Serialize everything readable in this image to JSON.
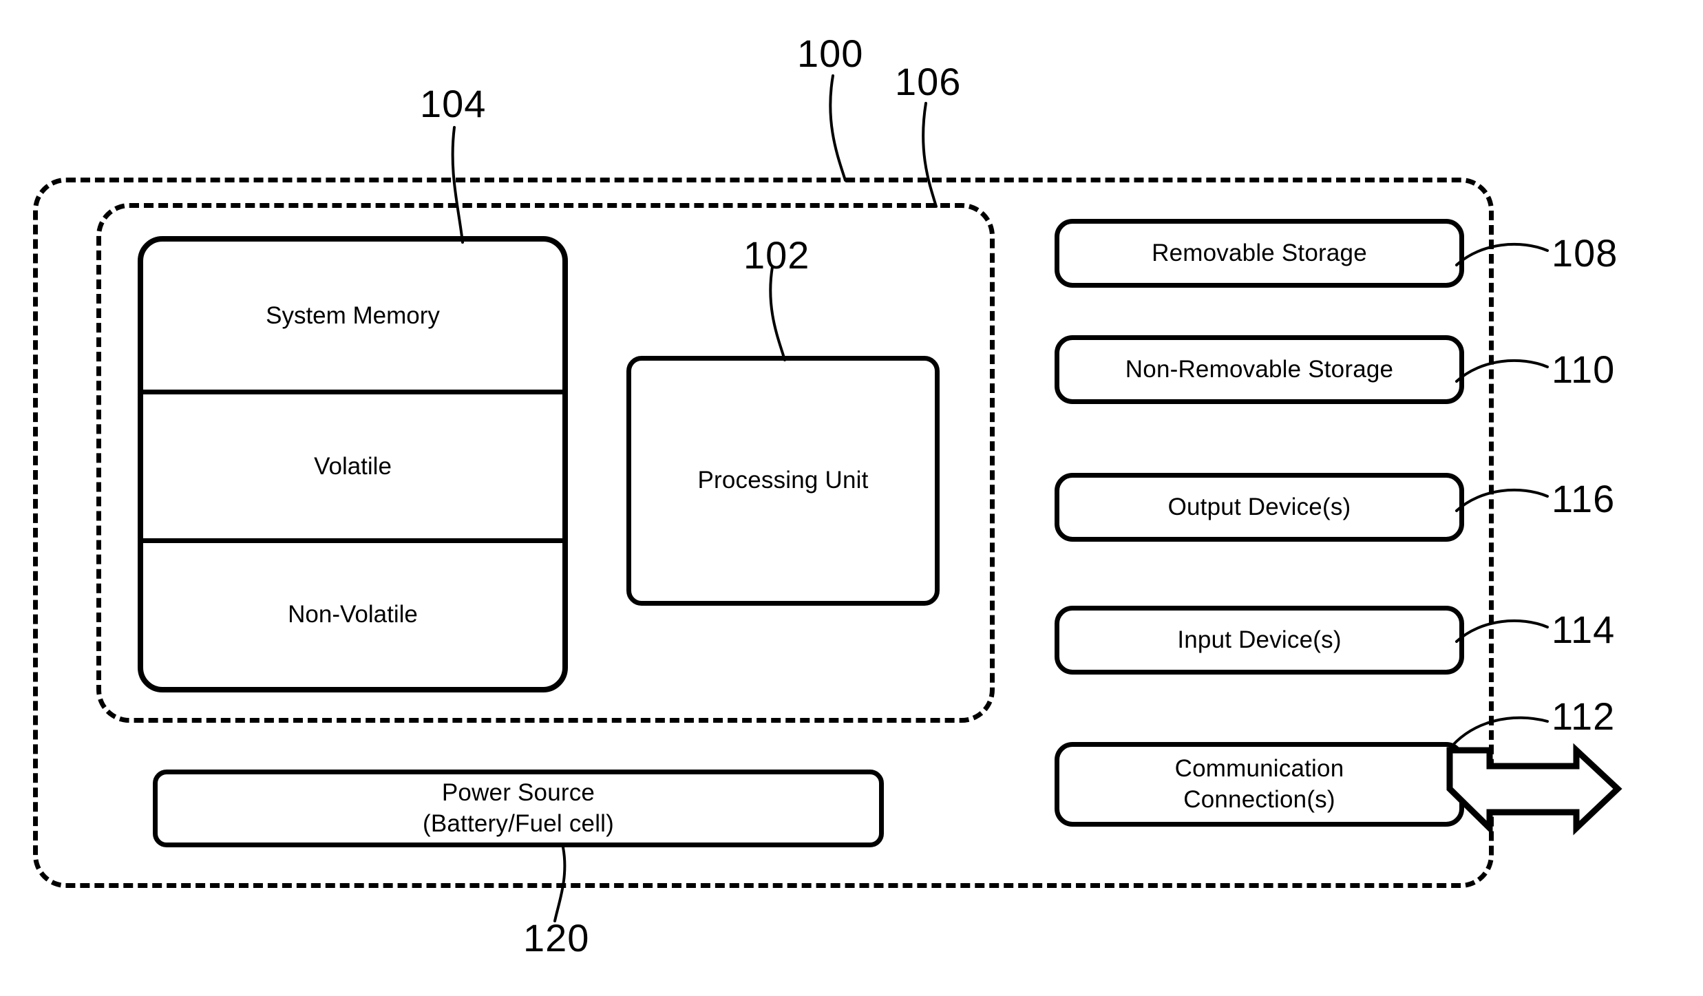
{
  "figure": {
    "type": "patent-block-diagram",
    "outer_boundary_ref": "100",
    "inner_boundary_ref": "106",
    "blocks": {
      "system_memory": {
        "ref": "104",
        "sections": [
          {
            "label": "System Memory"
          },
          {
            "label": "Volatile"
          },
          {
            "label": "Non-Volatile"
          }
        ]
      },
      "processing_unit": {
        "ref": "102",
        "label": "Processing Unit"
      },
      "power_source": {
        "ref": "120",
        "label": "Power Source\n(Battery/Fuel cell)"
      },
      "removable_storage": {
        "ref": "108",
        "label": "Removable Storage"
      },
      "non_removable_storage": {
        "ref": "110",
        "label": "Non-Removable Storage"
      },
      "output_devices": {
        "ref": "116",
        "label": "Output Device(s)"
      },
      "input_devices": {
        "ref": "114",
        "label": "Input Device(s)"
      },
      "communication_connections": {
        "ref": "112",
        "label": "Communication\nConnection(s)"
      }
    },
    "reference_numerals": {
      "r100": "100",
      "r102": "102",
      "r104": "104",
      "r106": "106",
      "r108": "108",
      "r110": "110",
      "r112": "112",
      "r114": "114",
      "r116": "116",
      "r120": "120"
    },
    "colors": {
      "line": "#000000",
      "background": "#ffffff"
    }
  }
}
